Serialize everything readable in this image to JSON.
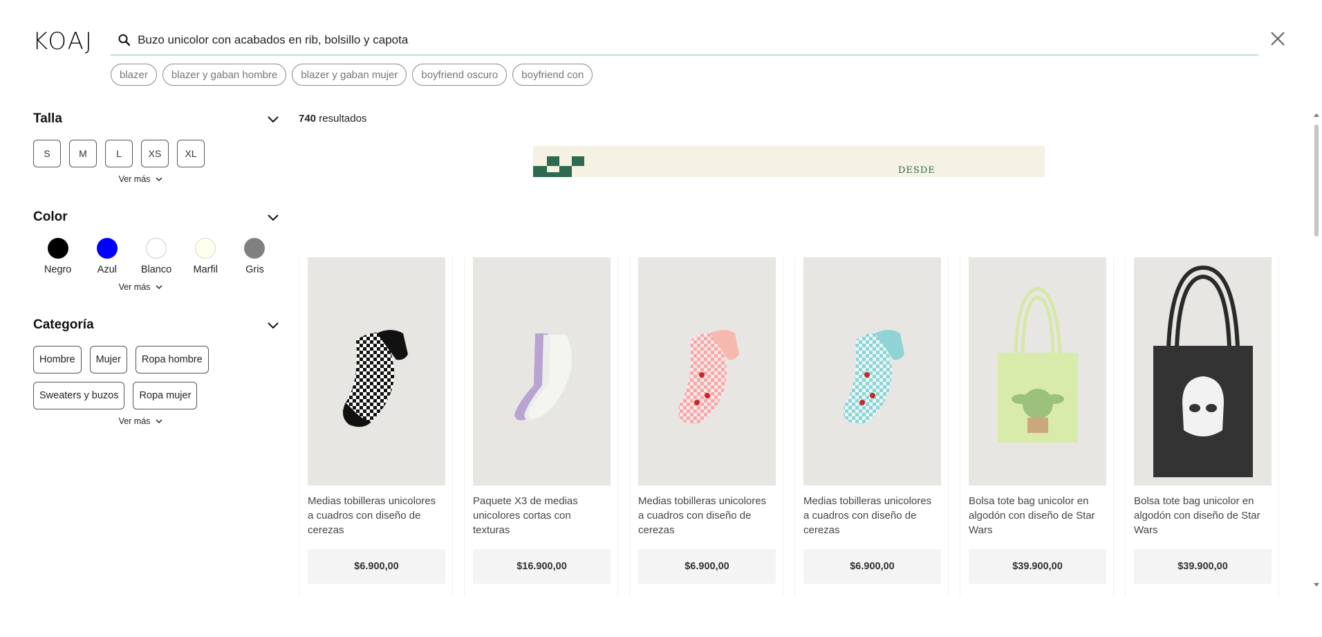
{
  "header": {
    "logo": "KOAJ",
    "search_value": "Buzo unicolor con acabados en rib, bolsillo y capota",
    "close_icon": "close-icon",
    "search_icon": "search-icon"
  },
  "suggestions": [
    "blazer",
    "blazer y gaban hombre",
    "blazer y gaban mujer",
    "boyfriend oscuro",
    "boyfriend con"
  ],
  "filters": {
    "size": {
      "title": "Talla",
      "options": [
        "S",
        "M",
        "L",
        "XS",
        "XL"
      ],
      "more": "Ver más"
    },
    "color": {
      "title": "Color",
      "options": [
        {
          "label": "Negro",
          "hex": "#000000"
        },
        {
          "label": "Azul",
          "hex": "#0000ff"
        },
        {
          "label": "Blanco",
          "hex": "#ffffff"
        },
        {
          "label": "Marfil",
          "hex": "#fffff0"
        },
        {
          "label": "Gris",
          "hex": "#808080"
        }
      ],
      "more": "Ver más"
    },
    "category": {
      "title": "Categoría",
      "options": [
        "Hombre",
        "Mujer",
        "Ropa hombre",
        "Sweaters y buzos",
        "Ropa mujer"
      ],
      "more": "Ver más"
    }
  },
  "results": {
    "count": "740",
    "label": "resultados"
  },
  "banner": {
    "text": "DESDE"
  },
  "products": [
    {
      "title": "Medias tobilleras unicolores a cuadros con diseño de cerezas",
      "price": "$6.900,00"
    },
    {
      "title": "Paquete X3 de medias unicolores cortas con texturas",
      "price": "$16.900,00"
    },
    {
      "title": "Medias tobilleras unicolores a cuadros con diseño de cerezas",
      "price": "$6.900,00"
    },
    {
      "title": "Medias tobilleras unicolores a cuadros con diseño de cerezas",
      "price": "$6.900,00"
    },
    {
      "title": "Bolsa tote bag unicolor en algodón con diseño de Star Wars",
      "price": "$39.900,00"
    },
    {
      "title": "Bolsa tote bag unicolor en algodón con diseño de Star Wars",
      "price": "$39.900,00"
    }
  ],
  "colors": {
    "accent_line": "#7fc5a9",
    "banner_green": "#2d6a4f"
  }
}
